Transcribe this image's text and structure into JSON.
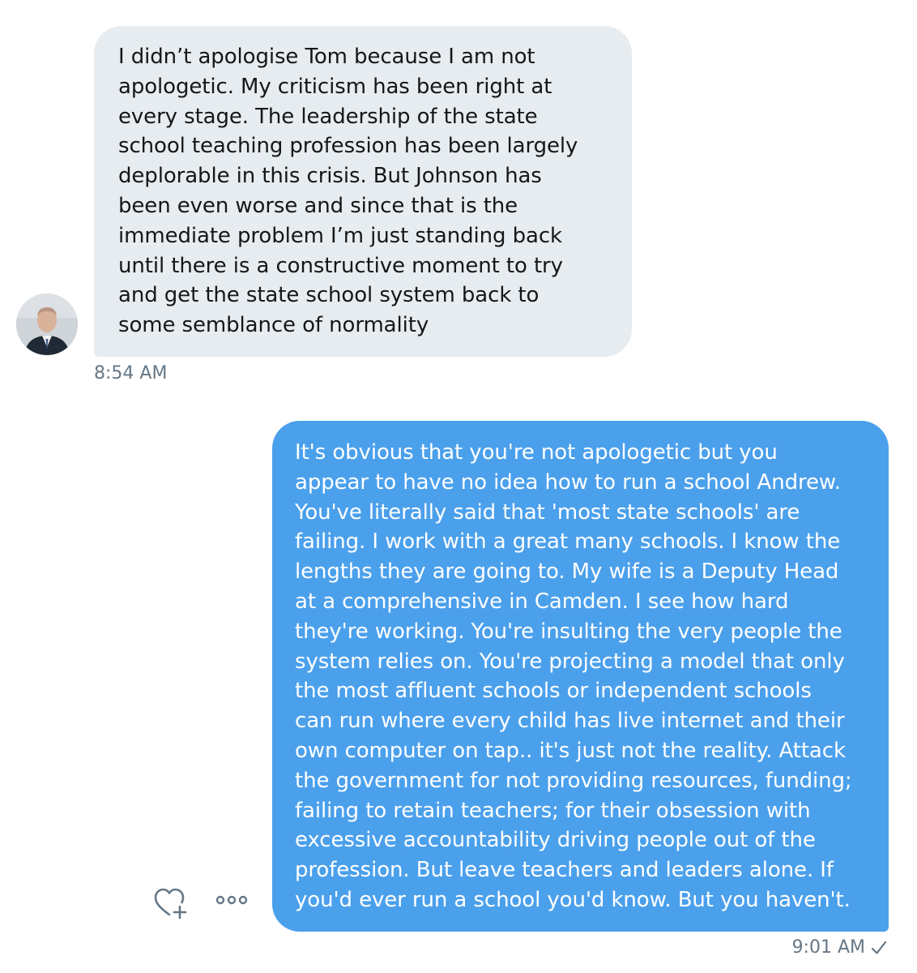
{
  "conversation": {
    "received": {
      "text": "I didn’t apologise Tom because I am not\napologetic. My criticism has been right at\nevery stage. The leadership of the state\nschool teaching profession has been largely\ndeplorable in this crisis. But Johnson has\nbeen even worse and since that is the\nimmediate problem I’m just standing back\nuntil there is a constructive moment to try\nand get the state school system back to\nsome semblance of normality",
      "time": "8:54 AM",
      "avatar_icon": "user-avatar"
    },
    "sent": {
      "text": "It's obvious that you're not apologetic but you\nappear to have no idea how to run a school Andrew.\nYou've literally said that 'most state schools' are\nfailing.  I work with a great many schools. I know the\nlengths they are going to.  My wife is a Deputy Head\nat a comprehensive in Camden.  I see how hard\nthey're working.  You're insulting the very people the\nsystem relies on.  You're projecting a model that only\nthe most affluent schools or independent schools\ncan run where every child has live internet and their\nown computer on tap.. it's just not the reality.  Attack\nthe government for not providing resources, funding;\nfailing to retain teachers; for their obsession with\nexcessive accountability driving people out of the\nprofession.  But leave teachers and leaders alone.  If\nyou'd ever run a school you'd know. But you haven't.",
      "time": "9:01 AM",
      "status_icon": "check-icon"
    },
    "actions": {
      "like_icon": "heart-plus-icon",
      "more_icon": "more-options-icon"
    }
  },
  "colors": {
    "received_bubble": "#e6ecf0",
    "sent_bubble": "#4ba0ec",
    "timestamp": "#657786"
  }
}
